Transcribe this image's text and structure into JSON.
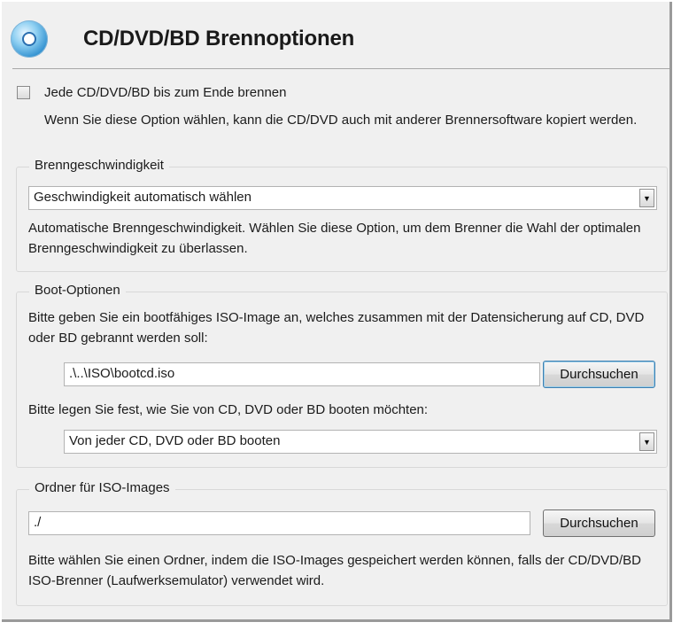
{
  "header": {
    "title": "CD/DVD/BD Brennoptionen"
  },
  "burn_to_end": {
    "checked": false,
    "label": "Jede CD/DVD/BD bis zum Ende brennen",
    "description": "Wenn Sie diese Option wählen, kann die CD/DVD auch mit anderer Brennersoftware kopiert werden."
  },
  "burn_speed": {
    "legend": "Brenngeschwindigkeit",
    "selected": "Geschwindigkeit automatisch wählen",
    "description": "Automatische Brenngeschwindigkeit. Wählen Sie diese Option, um dem Brenner die Wahl der optimalen Brenngeschwindigkeit zu überlassen."
  },
  "boot_options": {
    "legend": "Boot-Optionen",
    "iso_prompt": "Bitte geben Sie ein bootfähiges ISO-Image an, welches zusammen mit der Datensicherung auf CD, DVD oder BD gebrannt werden soll:",
    "iso_path": ".\\..\\ISO\\bootcd.iso",
    "browse_label": "Durchsuchen",
    "boot_prompt": "Bitte legen Sie fest, wie Sie von CD, DVD oder BD booten möchten:",
    "boot_selected": "Von jeder CD, DVD oder BD booten"
  },
  "iso_folder": {
    "legend": "Ordner für ISO-Images",
    "path": "./",
    "browse_label": "Durchsuchen",
    "description": "Bitte wählen Sie einen Ordner, indem die ISO-Images gespeichert werden können, falls der CD/DVD/BD ISO-Brenner (Laufwerksemulator) verwendet wird."
  },
  "icons": {
    "header": "disc-icon",
    "dropdown": "chevron-down-icon"
  },
  "colors": {
    "panel": "#f0f0f0",
    "focus_border": "#3c7fb1",
    "disc": "#2f8fcf"
  }
}
